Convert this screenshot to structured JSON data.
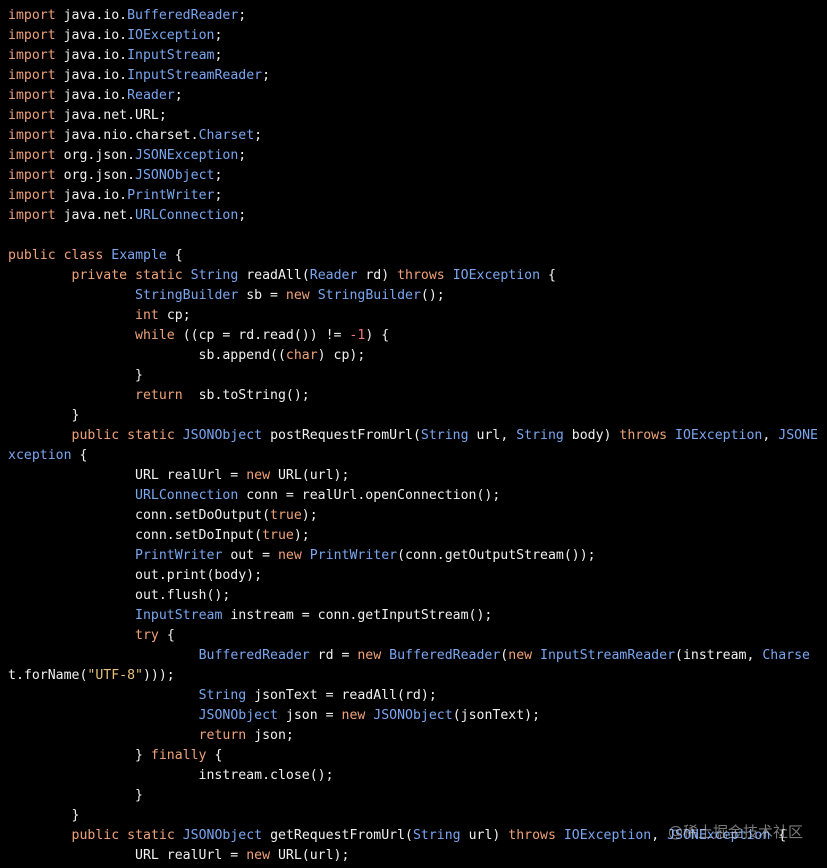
{
  "colors": {
    "background": "#000000",
    "plain": "#f0f0f0",
    "keyword": "#f0a27a",
    "type": "#7aa6f0",
    "number": "#f07a7a",
    "string": "#e6c07b"
  },
  "watermark": "@稀土掘金技术社区",
  "code_lines": [
    [
      [
        "k",
        "import"
      ],
      [
        "p",
        " java.io."
      ],
      [
        "t",
        "BufferedReader"
      ],
      [
        "p",
        ";"
      ]
    ],
    [
      [
        "k",
        "import"
      ],
      [
        "p",
        " java.io."
      ],
      [
        "t",
        "IOException"
      ],
      [
        "p",
        ";"
      ]
    ],
    [
      [
        "k",
        "import"
      ],
      [
        "p",
        " java.io."
      ],
      [
        "t",
        "InputStream"
      ],
      [
        "p",
        ";"
      ]
    ],
    [
      [
        "k",
        "import"
      ],
      [
        "p",
        " java.io."
      ],
      [
        "t",
        "InputStreamReader"
      ],
      [
        "p",
        ";"
      ]
    ],
    [
      [
        "k",
        "import"
      ],
      [
        "p",
        " java.io."
      ],
      [
        "t",
        "Reader"
      ],
      [
        "p",
        ";"
      ]
    ],
    [
      [
        "k",
        "import"
      ],
      [
        "p",
        " java.net.URL;"
      ]
    ],
    [
      [
        "k",
        "import"
      ],
      [
        "p",
        " java.nio.charset."
      ],
      [
        "t",
        "Charset"
      ],
      [
        "p",
        ";"
      ]
    ],
    [
      [
        "k",
        "import"
      ],
      [
        "p",
        " org.json."
      ],
      [
        "t",
        "JSONException"
      ],
      [
        "p",
        ";"
      ]
    ],
    [
      [
        "k",
        "import"
      ],
      [
        "p",
        " org.json."
      ],
      [
        "t",
        "JSONObject"
      ],
      [
        "p",
        ";"
      ]
    ],
    [
      [
        "k",
        "import"
      ],
      [
        "p",
        " java.io."
      ],
      [
        "t",
        "PrintWriter"
      ],
      [
        "p",
        ";"
      ]
    ],
    [
      [
        "k",
        "import"
      ],
      [
        "p",
        " java.net."
      ],
      [
        "t",
        "URLConnection"
      ],
      [
        "p",
        ";"
      ]
    ],
    [],
    [
      [
        "k",
        "public"
      ],
      [
        "p",
        " "
      ],
      [
        "k",
        "class"
      ],
      [
        "p",
        " "
      ],
      [
        "t",
        "Example"
      ],
      [
        "p",
        " {"
      ]
    ],
    [
      [
        "p",
        "        "
      ],
      [
        "k",
        "private"
      ],
      [
        "p",
        " "
      ],
      [
        "k",
        "static"
      ],
      [
        "p",
        " "
      ],
      [
        "t",
        "String"
      ],
      [
        "p",
        " readAll("
      ],
      [
        "t",
        "Reader"
      ],
      [
        "p",
        " rd) "
      ],
      [
        "k",
        "throws"
      ],
      [
        "p",
        " "
      ],
      [
        "t",
        "IOException"
      ],
      [
        "p",
        " {"
      ]
    ],
    [
      [
        "p",
        "                "
      ],
      [
        "t",
        "StringBuilder"
      ],
      [
        "p",
        " sb = "
      ],
      [
        "k",
        "new"
      ],
      [
        "p",
        " "
      ],
      [
        "t",
        "StringBuilder"
      ],
      [
        "p",
        "();"
      ]
    ],
    [
      [
        "p",
        "                "
      ],
      [
        "k",
        "int"
      ],
      [
        "p",
        " cp;"
      ]
    ],
    [
      [
        "p",
        "                "
      ],
      [
        "k",
        "while"
      ],
      [
        "p",
        " ((cp = rd.read()) != "
      ],
      [
        "n",
        "-1"
      ],
      [
        "p",
        ") {"
      ]
    ],
    [
      [
        "p",
        "                        sb.append(("
      ],
      [
        "k",
        "char"
      ],
      [
        "p",
        ") cp);"
      ]
    ],
    [
      [
        "p",
        "                }"
      ]
    ],
    [
      [
        "p",
        "                "
      ],
      [
        "k",
        "return"
      ],
      [
        "p",
        "  sb.toString();"
      ]
    ],
    [
      [
        "p",
        "        }"
      ]
    ],
    [
      [
        "p",
        "        "
      ],
      [
        "k",
        "public"
      ],
      [
        "p",
        " "
      ],
      [
        "k",
        "static"
      ],
      [
        "p",
        " "
      ],
      [
        "t",
        "JSONObject"
      ],
      [
        "p",
        " postRequestFromUrl("
      ],
      [
        "t",
        "String"
      ],
      [
        "p",
        " url, "
      ],
      [
        "t",
        "String"
      ],
      [
        "p",
        " body) "
      ],
      [
        "k",
        "throws"
      ],
      [
        "p",
        " "
      ],
      [
        "t",
        "IOException"
      ],
      [
        "p",
        ", "
      ],
      [
        "t",
        "JSONE"
      ]
    ],
    [
      [
        "t",
        "xception"
      ],
      [
        "p",
        " {"
      ]
    ],
    [
      [
        "p",
        "                URL realUrl = "
      ],
      [
        "k",
        "new"
      ],
      [
        "p",
        " URL(url);"
      ]
    ],
    [
      [
        "p",
        "                "
      ],
      [
        "t",
        "URLConnection"
      ],
      [
        "p",
        " conn = realUrl.openConnection();"
      ]
    ],
    [
      [
        "p",
        "                conn.setDoOutput("
      ],
      [
        "k",
        "true"
      ],
      [
        "p",
        ");"
      ]
    ],
    [
      [
        "p",
        "                conn.setDoInput("
      ],
      [
        "k",
        "true"
      ],
      [
        "p",
        ");"
      ]
    ],
    [
      [
        "p",
        "                "
      ],
      [
        "t",
        "PrintWriter"
      ],
      [
        "p",
        " out = "
      ],
      [
        "k",
        "new"
      ],
      [
        "p",
        " "
      ],
      [
        "t",
        "PrintWriter"
      ],
      [
        "p",
        "(conn.getOutputStream());"
      ]
    ],
    [
      [
        "p",
        "                out.print(body);"
      ]
    ],
    [
      [
        "p",
        "                out.flush();"
      ]
    ],
    [
      [
        "p",
        "                "
      ],
      [
        "t",
        "InputStream"
      ],
      [
        "p",
        " instream = conn.getInputStream();"
      ]
    ],
    [
      [
        "p",
        "                "
      ],
      [
        "k",
        "try"
      ],
      [
        "p",
        " {"
      ]
    ],
    [
      [
        "p",
        "                        "
      ],
      [
        "t",
        "BufferedReader"
      ],
      [
        "p",
        " rd = "
      ],
      [
        "k",
        "new"
      ],
      [
        "p",
        " "
      ],
      [
        "t",
        "BufferedReader"
      ],
      [
        "p",
        "("
      ],
      [
        "k",
        "new"
      ],
      [
        "p",
        " "
      ],
      [
        "t",
        "InputStreamReader"
      ],
      [
        "p",
        "(instream, "
      ],
      [
        "t",
        "Charse"
      ]
    ],
    [
      [
        "p",
        "t.forName("
      ],
      [
        "s",
        "\"UTF-8\""
      ],
      [
        "p",
        ")));"
      ]
    ],
    [
      [
        "p",
        "                        "
      ],
      [
        "t",
        "String"
      ],
      [
        "p",
        " jsonText = readAll(rd);"
      ]
    ],
    [
      [
        "p",
        "                        "
      ],
      [
        "t",
        "JSONObject"
      ],
      [
        "p",
        " json = "
      ],
      [
        "k",
        "new"
      ],
      [
        "p",
        " "
      ],
      [
        "t",
        "JSONObject"
      ],
      [
        "p",
        "(jsonText);"
      ]
    ],
    [
      [
        "p",
        "                        "
      ],
      [
        "k",
        "return"
      ],
      [
        "p",
        " json;"
      ]
    ],
    [
      [
        "p",
        "                } "
      ],
      [
        "k",
        "finally"
      ],
      [
        "p",
        " {"
      ]
    ],
    [
      [
        "p",
        "                        instream.close();"
      ]
    ],
    [
      [
        "p",
        "                }"
      ]
    ],
    [
      [
        "p",
        "        }"
      ]
    ],
    [
      [
        "p",
        "        "
      ],
      [
        "k",
        "public"
      ],
      [
        "p",
        " "
      ],
      [
        "k",
        "static"
      ],
      [
        "p",
        " "
      ],
      [
        "t",
        "JSONObject"
      ],
      [
        "p",
        " getRequestFromUrl("
      ],
      [
        "t",
        "String"
      ],
      [
        "p",
        " url) "
      ],
      [
        "k",
        "throws"
      ],
      [
        "p",
        " "
      ],
      [
        "t",
        "IOException"
      ],
      [
        "p",
        ", "
      ],
      [
        "t",
        "JSONException"
      ],
      [
        "p",
        " {"
      ]
    ],
    [
      [
        "p",
        "                URL realUrl = "
      ],
      [
        "k",
        "new"
      ],
      [
        "p",
        " URL(url);"
      ]
    ]
  ]
}
